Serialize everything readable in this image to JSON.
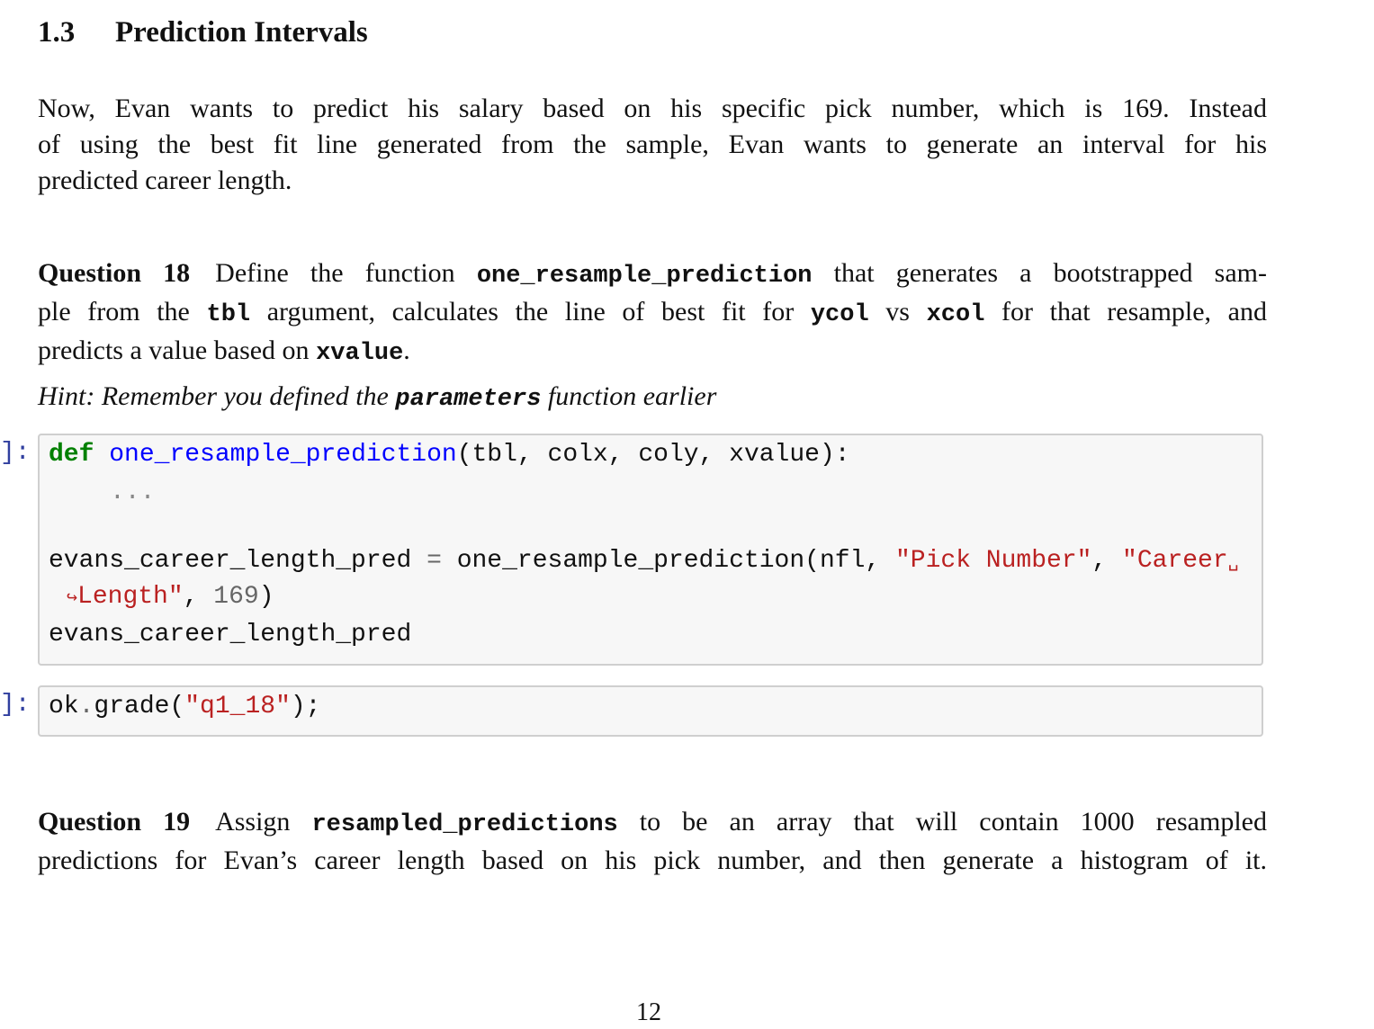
{
  "section": {
    "number": "1.3",
    "title": "Prediction Intervals"
  },
  "intro": {
    "lines": [
      "Now, Evan wants to predict his salary based on his specific pick number, which is 169.  Instead",
      "of using the best fit line generated from the sample, Evan wants to generate an interval for his",
      "predicted career length."
    ]
  },
  "question18": {
    "label": "Question 18",
    "line1_pre": "Define the function ",
    "line1_code": "one_resample_prediction",
    "line1_post": " that generates a bootstrapped sam-",
    "line2_a": "ple from the ",
    "line2_code1": "tbl",
    "line2_b": " argument, calculates the line of best fit for ",
    "line2_code2": "ycol",
    "line2_c": " vs ",
    "line2_code3": "xcol",
    "line2_d": " for that resample, and",
    "line3_pre": "predicts a value based on ",
    "line3_code": "xvalue",
    "line3_post": ".",
    "hint_pre": "Hint: Remember you defined the ",
    "hint_code": "parameters",
    "hint_post": " function earlier"
  },
  "cell1": {
    "prompt": "]:",
    "def_kw": "def",
    "fn_name": "one_resample_prediction",
    "signature": "(tbl, colx, coly, xvalue):",
    "body": "...",
    "assign_var": "evans_career_length_pred ",
    "assign_op": "=",
    "call": " one_resample_prediction(nfl, ",
    "arg1": "\"Pick Number\"",
    "comma": ", ",
    "arg2_start": "\"Career",
    "space_marker": "␣",
    "wrap_marker": "↪",
    "arg2_end": "Length\"",
    "comma2": ", ",
    "arg3": "169",
    "close": ")",
    "last_line": "evans_career_length_pred"
  },
  "cell2": {
    "prompt": "]:",
    "obj": "ok",
    "dot": ".",
    "method": "grade(",
    "arg": "\"q1_18\"",
    "close": ");"
  },
  "question19": {
    "label": "Question 19",
    "line1_pre": "Assign ",
    "line1_code": "resampled_predictions",
    "line1_post": " to be an array that will contain 1000 resampled",
    "line2": "predictions for Evan’s career length based on his pick number, and then generate a histogram of it."
  },
  "page_number": "12"
}
